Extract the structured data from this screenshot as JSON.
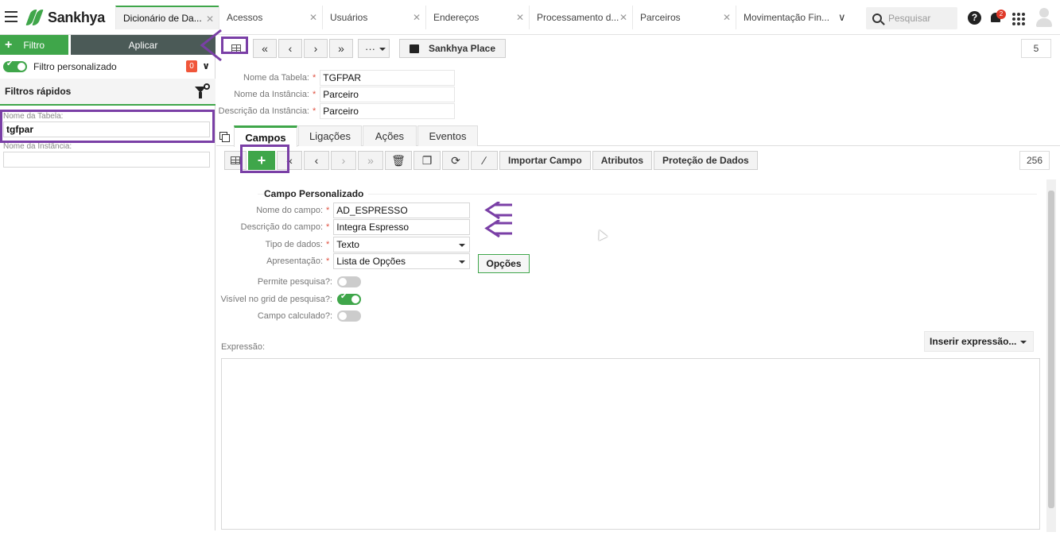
{
  "app": {
    "brand": "Sankhya"
  },
  "tabs": [
    {
      "label": "Dicionário de Da..."
    },
    {
      "label": "Acessos"
    },
    {
      "label": "Usuários"
    },
    {
      "label": "Endereços"
    },
    {
      "label": "Processamento d..."
    },
    {
      "label": "Parceiros"
    },
    {
      "label": "Movimentação Fin..."
    }
  ],
  "search": {
    "placeholder": "Pesquisar"
  },
  "notifications": {
    "count": "2"
  },
  "left_panel": {
    "filtro_label": "Filtro",
    "aplicar_label": "Aplicar",
    "filtro_personalizado": "Filtro personalizado",
    "filter_count": "0",
    "filtros_rapidos": "Filtros rápidos",
    "nome_tabela_label": "Nome da Tabela:",
    "nome_tabela_value": "tgfpar",
    "nome_instancia_label": "Nome da Instância:",
    "nome_instancia_value": ""
  },
  "main_toolbar": {
    "sankhya_place": "Sankhya Place",
    "record_count": "5"
  },
  "header_form": {
    "nome_tabela_label": "Nome da Tabela:",
    "nome_tabela_value": "TGFPAR",
    "nome_instancia_label": "Nome da Instância:",
    "nome_instancia_value": "Parceiro",
    "descricao_label": "Descrição da Instância:",
    "descricao_value": "Parceiro"
  },
  "subtabs": [
    "Campos",
    "Ligações",
    "Ações",
    "Eventos"
  ],
  "campos_toolbar": {
    "importar": "Importar Campo",
    "atributos": "Atributos",
    "protecao": "Proteção de Dados",
    "record_count": "256"
  },
  "campo_form": {
    "section_title": "Campo Personalizado",
    "nome_label": "Nome do campo:",
    "nome_value": "AD_ESPRESSO",
    "descricao_label": "Descrição do campo:",
    "descricao_value": "Integra Espresso",
    "tipo_label": "Tipo de dados:",
    "tipo_value": "Texto",
    "apresentacao_label": "Apresentação:",
    "apresentacao_value": "Lista de Opções",
    "opcoes_label": "Opções",
    "permite_label": "Permite pesquisa?:",
    "permite_value": false,
    "visivel_label": "Visível no grid de pesquisa?:",
    "visivel_value": true,
    "calculado_label": "Campo calculado?:",
    "calculado_value": false
  },
  "expressao": {
    "label": "Expressão:",
    "insert_label": "Inserir expressão..."
  },
  "colors": {
    "accent": "#3fa64a",
    "annotation": "#7a3fa6",
    "dark_button": "#4b5a57"
  }
}
